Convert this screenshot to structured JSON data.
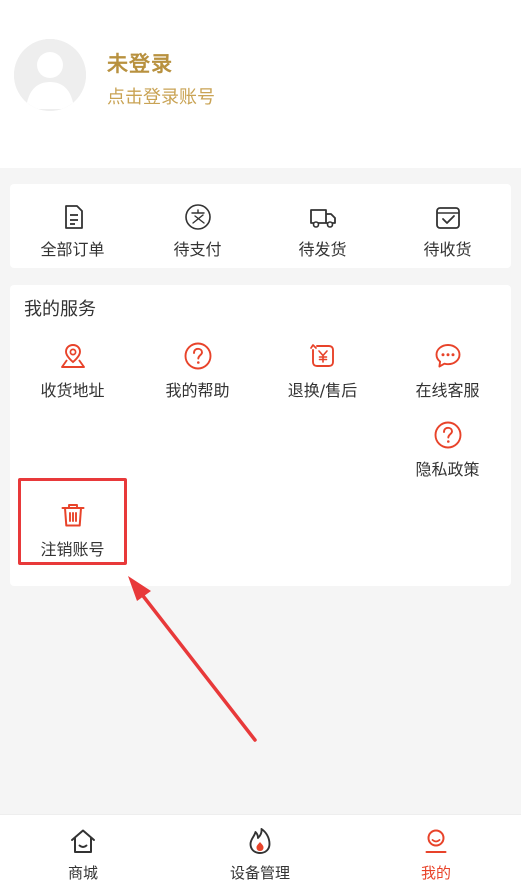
{
  "colors": {
    "brand_gold": "#b8913f",
    "accent": "#e8432a",
    "highlight": "#e8393a"
  },
  "header": {
    "title": "未登录",
    "subtitle": "点击登录账号",
    "avatar_icon": "user-avatar-icon"
  },
  "orders": [
    {
      "label": "全部订单",
      "icon": "order-list-icon"
    },
    {
      "label": "待支付",
      "icon": "payment-icon"
    },
    {
      "label": "待发货",
      "icon": "truck-icon"
    },
    {
      "label": "待收货",
      "icon": "box-check-icon"
    }
  ],
  "services": {
    "title": "我的服务",
    "items": [
      {
        "label": "收货地址",
        "icon": "location-map-icon"
      },
      {
        "label": "我的帮助",
        "icon": "help-circle-icon"
      },
      {
        "label": "退换/售后",
        "icon": "refund-icon"
      },
      {
        "label": "在线客服",
        "icon": "chat-bubble-icon"
      },
      {
        "label": "隐私政策",
        "icon": "help-circle-icon"
      },
      {
        "label": "注销账号",
        "icon": "trash-icon"
      }
    ]
  },
  "tabbar": [
    {
      "label": "商城",
      "icon": "home-icon",
      "active": false
    },
    {
      "label": "设备管理",
      "icon": "flame-icon",
      "active": false
    },
    {
      "label": "我的",
      "icon": "user-icon",
      "active": true
    }
  ]
}
